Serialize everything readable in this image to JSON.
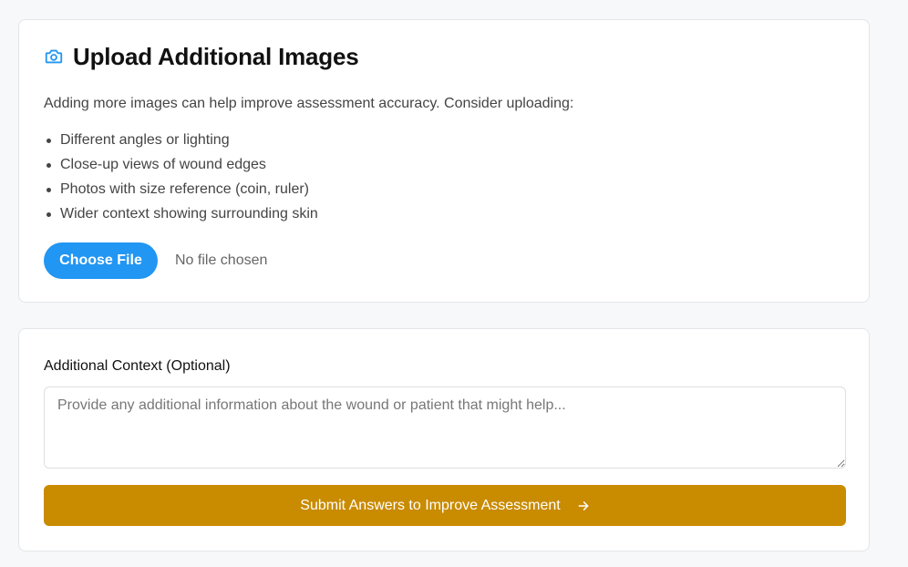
{
  "upload_section": {
    "icon": "camera-icon",
    "title": "Upload Additional Images",
    "intro": "Adding more images can help improve assessment accuracy. Consider uploading:",
    "tips": [
      "Different angles or lighting",
      "Close-up views of wound edges",
      "Photos with size reference (coin, ruler)",
      "Wider context showing surrounding skin"
    ],
    "choose_file_label": "Choose File",
    "file_status": "No file chosen"
  },
  "context_section": {
    "label": "Additional Context (Optional)",
    "placeholder": "Provide any additional information about the wound or patient that might help...",
    "value": "",
    "submit_label": "Submit Answers to Improve Assessment",
    "submit_icon": "arrow-right-icon"
  },
  "colors": {
    "page_background": "#f7f8fa",
    "card_background": "#ffffff",
    "accent_blue": "#2196f3",
    "submit_gold": "#c98b00"
  }
}
